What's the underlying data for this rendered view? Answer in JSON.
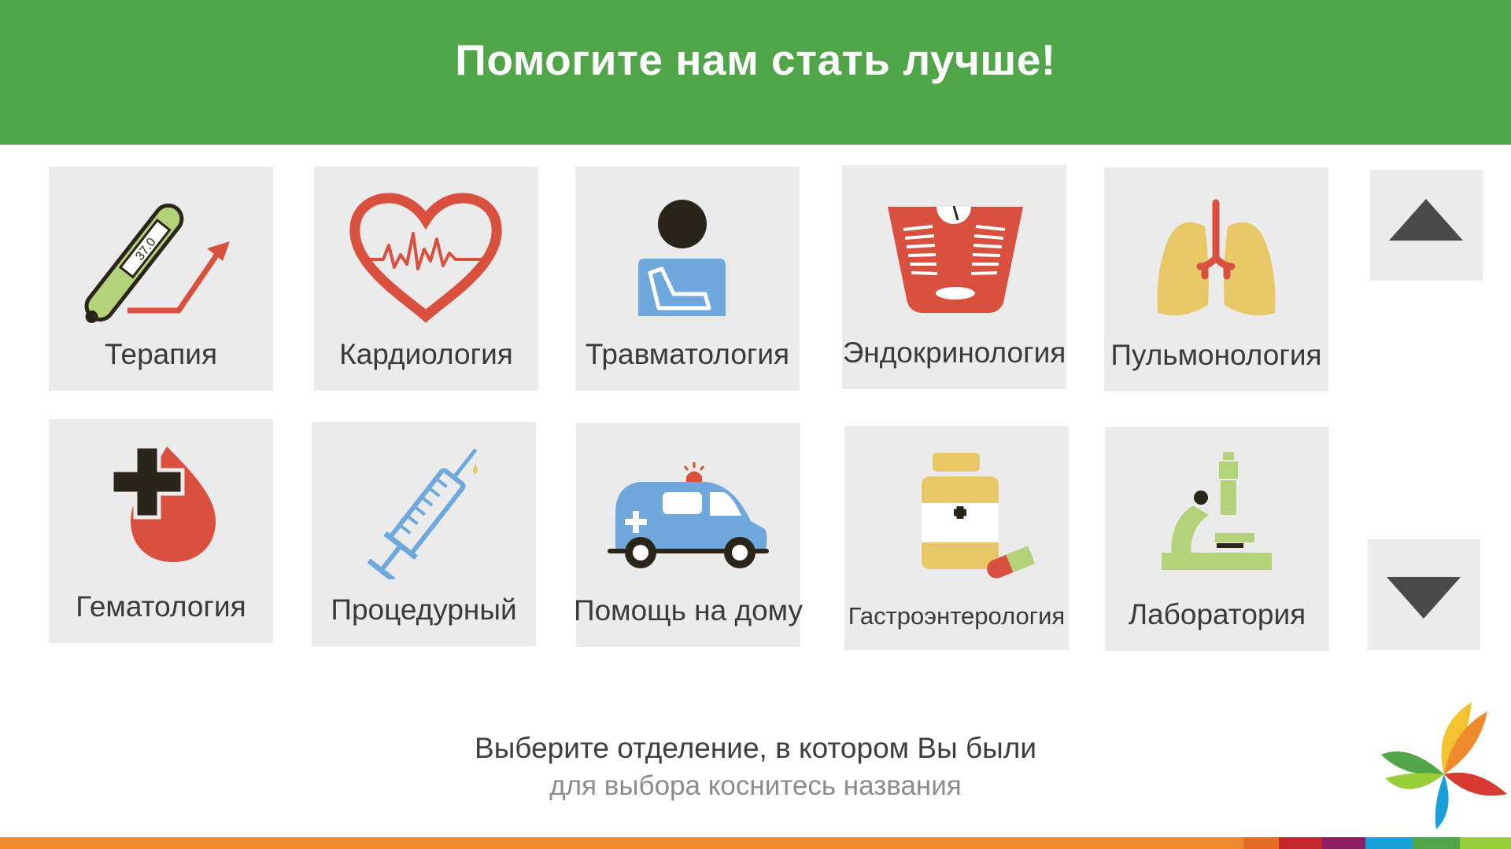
{
  "header": {
    "title": "Помогите нам стать лучше!"
  },
  "departments": [
    {
      "label": "Терапия",
      "icon": "thermometer-icon"
    },
    {
      "label": "Кардиология",
      "icon": "heart-icon"
    },
    {
      "label": "Травматология",
      "icon": "arm-sling-icon"
    },
    {
      "label": "Эндокринология",
      "icon": "scale-icon"
    },
    {
      "label": "Пульмонология",
      "icon": "lungs-icon"
    },
    {
      "label": "Гематология",
      "icon": "blood-drop-icon"
    },
    {
      "label": "Процедурный",
      "icon": "syringe-icon"
    },
    {
      "label": "Помощь на дому",
      "icon": "ambulance-icon"
    },
    {
      "label": "Гастроэнтерология",
      "icon": "medicine-bottle-icon"
    },
    {
      "label": "Лаборатория",
      "icon": "microscope-icon"
    }
  ],
  "thermometer_reading": "37.0",
  "footer": {
    "instruction": "Выберите отделение, в котором Вы были",
    "hint": "для выбора коснитесь названия"
  },
  "colors": {
    "header": "#4fa547",
    "tile": "#ebebeb",
    "icon_red": "#d9503f",
    "icon_blue": "#6fa8dc",
    "icon_green": "#b4d27a",
    "icon_yellow": "#e8c766",
    "icon_dark": "#2b2419",
    "stripe": "#ef8b2c"
  }
}
